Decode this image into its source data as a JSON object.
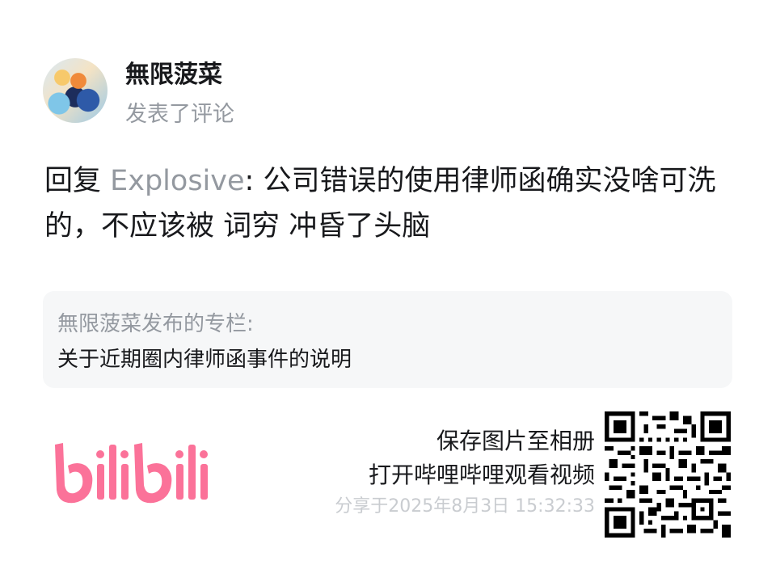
{
  "author": {
    "name": "無限菠菜",
    "action": "发表了评论"
  },
  "comment": {
    "reply_prefix": "回复 ",
    "mention": "Explosive",
    "text": ": 公司错误的使用律师函确实没啥可洗的，不应该被 词穷 冲昏了头脑"
  },
  "column": {
    "label": "無限菠菜发布的专栏:",
    "title": "关于近期圈内律师函事件的说明"
  },
  "share": {
    "line1": "保存图片至相册",
    "line2": "打开哔哩哔哩观看视频",
    "time": "分享于2025年8月3日 15:32:33"
  },
  "brand": {
    "logo": "bilibili",
    "accent_color": "#fb7299"
  },
  "icons": {
    "qr": "qr-code-icon",
    "avatar": "user-avatar"
  }
}
